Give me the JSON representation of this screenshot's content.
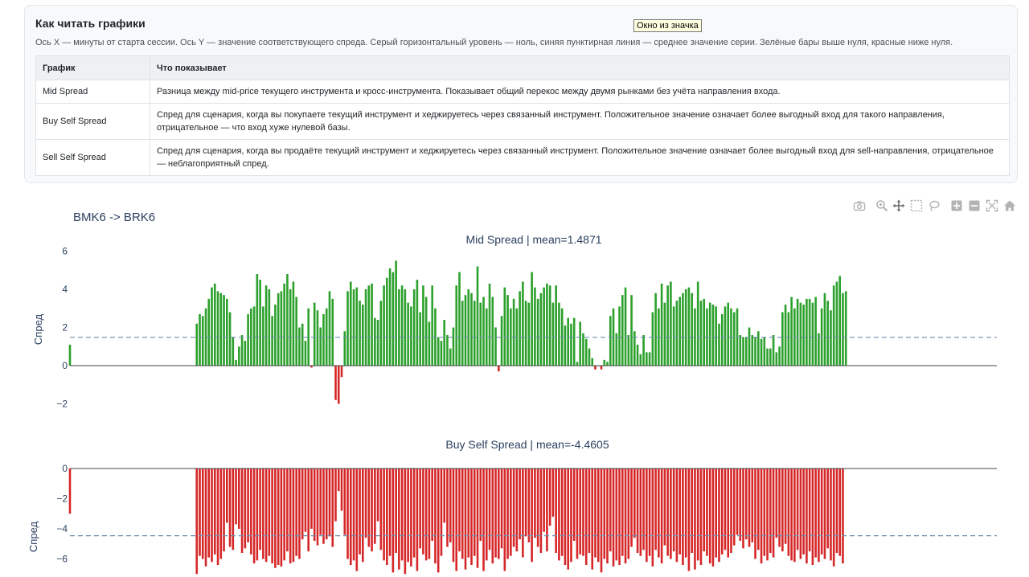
{
  "info": {
    "title": "Как читать графики",
    "description": "Ось X — минуты от старта сессии. Ось Y — значение соответствующего спреда. Серый горизонтальный уровень — ноль, синяя пунктирная линия — среднее значение серии. Зелёные бары выше нуля, красные ниже нуля.",
    "table": {
      "headers": [
        "График",
        "Что показывает"
      ],
      "rows": [
        {
          "name": "Mid Spread",
          "text": "Разница между mid-price текущего инструмента и кросс-инструмента. Показывает общий перекос между двумя рынками без учёта направления входа."
        },
        {
          "name": "Buy Self Spread",
          "text": "Спред для сценария, когда вы покупаете текущий инструмент и хеджируетесь через связанный инструмент. Положительное значение означает более выгодный вход для такого направления, отрицательное — что вход хуже нулевой базы."
        },
        {
          "name": "Sell Self Spread",
          "text": "Спред для сценария, когда вы продаёте текущий инструмент и хеджируетесь через связанный инструмент. Положительное значение означает более выгодный вход для sell-направления, отрицательное — неблагоприятный спред."
        }
      ]
    }
  },
  "tooltip": "Окно из значка",
  "modebar": [
    "camera-icon",
    "zoom-icon",
    "pan-icon",
    "box-select-icon",
    "lasso-icon",
    "zoom-in-icon",
    "zoom-out-icon",
    "autoscale-icon",
    "reset-home-icon"
  ],
  "figure_title": "BMK6 -> BRK6",
  "chart_data": [
    {
      "type": "bar",
      "title": "Mid Spread | mean=1.4871",
      "ylabel": "Спред",
      "yticks": [
        -2,
        0,
        2,
        4,
        6
      ],
      "ylim": [
        -2.5,
        6.3
      ],
      "mean": 1.4871,
      "colors": {
        "positive": "#2ca02c",
        "negative": "#d62728",
        "mean_line": "#6f8fb0",
        "zero_line": "#444444"
      },
      "x": [
        0,
        42,
        43,
        44,
        45,
        46,
        47,
        48,
        49,
        50,
        51,
        52,
        53,
        54,
        55,
        56,
        57,
        58,
        59,
        60,
        61,
        62,
        63,
        64,
        65,
        66,
        67,
        68,
        69,
        70,
        71,
        72,
        73,
        74,
        75,
        76,
        77,
        78,
        79,
        80,
        81,
        82,
        83,
        84,
        85,
        86,
        87,
        88,
        89,
        90,
        91,
        92,
        93,
        94,
        95,
        96,
        97,
        98,
        99,
        100,
        101,
        102,
        103,
        104,
        105,
        106,
        107,
        108,
        109,
        110,
        111,
        112,
        113,
        114,
        115,
        116,
        117,
        118,
        119,
        120,
        121,
        122,
        123,
        124,
        125,
        126,
        127,
        128,
        129,
        130,
        131,
        132,
        133,
        134,
        135,
        136,
        137,
        138,
        139,
        140,
        141,
        142,
        143,
        144,
        145,
        146,
        147,
        148,
        149,
        150,
        151,
        152,
        153,
        154,
        155,
        156,
        157,
        158,
        159,
        160,
        161,
        162,
        163,
        164,
        165,
        166,
        167,
        168,
        169,
        170,
        171,
        172,
        173,
        174,
        175,
        176,
        177,
        178,
        179,
        180,
        181,
        182,
        183,
        184,
        185,
        186,
        187,
        188,
        189,
        190,
        191,
        192,
        193,
        194,
        195,
        196,
        197,
        198,
        199,
        200,
        201,
        202,
        203,
        204,
        205,
        206,
        207,
        208,
        209,
        210,
        211,
        212,
        213,
        214,
        215,
        216,
        217,
        218,
        219,
        220,
        221,
        222,
        223,
        224,
        225,
        226,
        227,
        228,
        229,
        230,
        231,
        232,
        233,
        234,
        235,
        236,
        237,
        238,
        239,
        240,
        241,
        242,
        243,
        244,
        245,
        246,
        247,
        248,
        249,
        250,
        251,
        252,
        253,
        254,
        255,
        256,
        257,
        258,
        259,
        260,
        261,
        262,
        263,
        264,
        265,
        266,
        267,
        268,
        269,
        270,
        271,
        272,
        273,
        274,
        275,
        276,
        277,
        278,
        279,
        280,
        281,
        282,
        283,
        284,
        285,
        286,
        287,
        288,
        289,
        290,
        291,
        292,
        293,
        294,
        295,
        296,
        297,
        298,
        299,
        300,
        301,
        302,
        303,
        304,
        305,
        306,
        307
      ],
      "values": [
        1.1,
        2.2,
        2.7,
        2.6,
        3.0,
        3.5,
        4.1,
        4.3,
        3.9,
        3.8,
        3.7,
        3.5,
        2.8,
        1.5,
        0.3,
        1.0,
        1.6,
        1.3,
        2.7,
        3.0,
        3.1,
        4.8,
        4.5,
        3.1,
        4.2,
        4.0,
        2.6,
        3.2,
        3.8,
        3.9,
        4.3,
        4.8,
        4.0,
        4.4,
        3.6,
        2.0,
        2.2,
        1.3,
        3.0,
        -0.1,
        3.3,
        2.9,
        2.0,
        2.7,
        3.0,
        3.9,
        3.5,
        -1.8,
        -2.0,
        -0.6,
        1.8,
        3.9,
        4.4,
        4.0,
        4.1,
        3.4,
        3.2,
        4.0,
        4.2,
        4.3,
        2.5,
        2.4,
        3.4,
        4.2,
        4.6,
        5.1,
        4.9,
        5.5,
        4.0,
        4.2,
        4.0,
        3.3,
        3.1,
        4.0,
        4.5,
        2.8,
        4.2,
        3.6,
        2.3,
        4.2,
        3.0,
        1.5,
        1.3,
        2.4,
        1.6,
        0.9,
        2.0,
        4.2,
        4.9,
        3.4,
        3.7,
        4.0,
        3.8,
        3.4,
        5.2,
        3.3,
        3.6,
        3.0,
        4.3,
        3.6,
        2.0,
        -0.3,
        2.6,
        4.1,
        3.7,
        3.0,
        3.5,
        3.0,
        3.9,
        4.4,
        3.4,
        3.3,
        4.9,
        4.1,
        3.5,
        3.8,
        4.1,
        4.3,
        4.2,
        3.3,
        4.2,
        3.3,
        3.0,
        2.1,
        2.5,
        2.2,
        2.5,
        0.2,
        2.3,
        1.7,
        1.4,
        0.9,
        0.4,
        -0.2,
        0.0,
        -0.2,
        0.3,
        0.2,
        2.6,
        3.0,
        1.7,
        3.1,
        3.7,
        4.1,
        1.6,
        3.7,
        1.8,
        1.1,
        0.6,
        1.6,
        0.7,
        0.7,
        2.8,
        3.8,
        3.0,
        4.3,
        3.3,
        4.2,
        4.4,
        3.1,
        3.4,
        3.6,
        3.8,
        4.0,
        4.1,
        3.8,
        3.0,
        4.4,
        3.4,
        3.5,
        3.0,
        3.3,
        3.2,
        3.1,
        2.2,
        2.7,
        3.1,
        3.3,
        3.0,
        2.8,
        3.0,
        1.6,
        1.5,
        1.5,
        2.0,
        1.6,
        1.5,
        1.8,
        1.4,
        1.5,
        0.9,
        0.9,
        1.6,
        0.7,
        1.0,
        2.8,
        3.2,
        2.8,
        3.6,
        3.0,
        3.5,
        3.3,
        3.2,
        3.5,
        3.5,
        3.3,
        3.6,
        1.7,
        3.0,
        3.8,
        3.4,
        2.9,
        4.2,
        4.4,
        4.7,
        3.8,
        3.9
      ]
    },
    {
      "type": "bar",
      "title": "Buy Self Spread | mean=-4.4605",
      "ylabel": "Спред",
      "yticks": [
        -6,
        -4,
        -2,
        0
      ],
      "ylim": [
        -7.0,
        0.4
      ],
      "mean": -4.4605,
      "colors": {
        "positive": "#2ca02c",
        "negative": "#d62728",
        "mean_line": "#6f8fb0",
        "zero_line": "#444444"
      },
      "x": [
        0,
        42,
        43,
        44,
        45,
        46,
        47,
        48,
        49,
        50,
        51,
        52,
        53,
        54,
        55,
        56,
        57,
        58,
        59,
        60,
        61,
        62,
        63,
        64,
        65,
        66,
        67,
        68,
        69,
        70,
        71,
        72,
        73,
        74,
        75,
        76,
        77,
        78,
        79,
        80,
        81,
        82,
        83,
        84,
        85,
        86,
        87,
        88,
        89,
        90,
        91,
        92,
        93,
        94,
        95,
        96,
        97,
        98,
        99,
        100,
        101,
        102,
        103,
        104,
        105,
        106,
        107,
        108,
        109,
        110,
        111,
        112,
        113,
        114,
        115,
        116,
        117,
        118,
        119,
        120,
        121,
        122,
        123,
        124,
        125,
        126,
        127,
        128,
        129,
        130,
        131,
        132,
        133,
        134,
        135,
        136,
        137,
        138,
        139,
        140,
        141,
        142,
        143,
        144,
        145,
        146,
        147,
        148,
        149,
        150,
        151,
        152,
        153,
        154,
        155,
        156,
        157,
        158,
        159,
        160,
        161,
        162,
        163,
        164,
        165,
        166,
        167,
        168,
        169,
        170,
        171,
        172,
        173,
        174,
        175,
        176,
        177,
        178,
        179,
        180,
        181,
        182,
        183,
        184,
        185,
        186,
        187,
        188,
        189,
        190,
        191,
        192,
        193,
        194,
        195,
        196,
        197,
        198,
        199,
        200,
        201,
        202,
        203,
        204,
        205,
        206,
        207,
        208,
        209,
        210,
        211,
        212,
        213,
        214,
        215,
        216,
        217,
        218,
        219,
        220,
        221,
        222,
        223,
        224,
        225,
        226,
        227,
        228,
        229,
        230,
        231,
        232,
        233,
        234,
        235,
        236,
        237,
        238,
        239,
        240,
        241,
        242,
        243,
        244,
        245,
        246,
        247,
        248,
        249,
        250,
        251,
        252,
        253,
        254,
        255,
        256,
        257,
        258,
        259,
        260,
        261,
        262,
        263,
        264,
        265,
        266,
        267,
        268,
        269,
        270,
        271,
        272,
        273,
        274,
        275,
        276,
        277,
        278,
        279,
        280,
        281,
        282,
        283,
        284,
        285,
        286,
        287,
        288,
        289,
        290,
        291,
        292,
        293,
        294,
        295,
        296,
        297,
        298,
        299,
        300,
        301,
        302,
        303,
        304,
        305,
        306,
        307
      ],
      "values": [
        -3.0,
        -7.0,
        -5.8,
        -6.0,
        -6.5,
        -5.9,
        -6.2,
        -5.7,
        -6.4,
        -6.0,
        -5.5,
        -3.6,
        -5.2,
        -5.4,
        -3.7,
        -4.0,
        -5.6,
        -5.3,
        -4.9,
        -5.7,
        -6.3,
        -6.1,
        -5.4,
        -6.0,
        -6.2,
        -5.8,
        -6.3,
        -6.6,
        -6.4,
        -6.5,
        -6.1,
        -5.5,
        -6.3,
        -6.2,
        -5.8,
        -6.0,
        -4.7,
        -4.2,
        -5.5,
        -4.0,
        -4.8,
        -5.1,
        -4.4,
        -5.0,
        -4.7,
        -4.5,
        -5.2,
        -3.5,
        -1.5,
        -2.8,
        -4.4,
        -6.0,
        -6.4,
        -6.1,
        -6.8,
        -5.7,
        -6.2,
        -4.6,
        -5.2,
        -5.5,
        -5.0,
        -3.5,
        -5.4,
        -6.1,
        -6.4,
        -5.8,
        -6.9,
        -5.6,
        -6.7,
        -6.1,
        -7.0,
        -6.2,
        -6.5,
        -5.9,
        -6.8,
        -5.3,
        -5.7,
        -6.1,
        -6.0,
        -4.8,
        -6.3,
        -6.9,
        -5.8,
        -3.6,
        -5.2,
        -4.9,
        -6.2,
        -6.8,
        -5.5,
        -6.0,
        -6.7,
        -5.9,
        -6.4,
        -5.8,
        -6.6,
        -4.8,
        -6.8,
        -6.1,
        -5.4,
        -6.3,
        -5.9,
        -6.0,
        -5.3,
        -6.8,
        -6.0,
        -5.8,
        -5.2,
        -5.5,
        -4.7,
        -5.9,
        -4.5,
        -4.9,
        -6.2,
        -4.6,
        -5.2,
        -5.6,
        -4.2,
        -5.5,
        -3.8,
        -3.2,
        -5.6,
        -6.1,
        -5.8,
        -6.4,
        -6.7,
        -6.2,
        -4.8,
        -6.0,
        -5.7,
        -5.8,
        -6.4,
        -5.6,
        -6.7,
        -5.9,
        -6.2,
        -6.9,
        -6.0,
        -6.3,
        -5.5,
        -6.5,
        -6.1,
        -6.4,
        -5.8,
        -6.3,
        -6.0,
        -5.2,
        -4.6,
        -5.6,
        -5.8,
        -5.4,
        -6.2,
        -5.8,
        -6.5,
        -5.4,
        -5.9,
        -6.3,
        -5.1,
        -5.8,
        -6.0,
        -5.5,
        -6.2,
        -5.7,
        -6.4,
        -5.9,
        -6.8,
        -5.6,
        -6.7,
        -6.1,
        -6.4,
        -5.5,
        -5.8,
        -6.3,
        -6.5,
        -5.9,
        -6.2,
        -5.7,
        -5.4,
        -5.9,
        -5.6,
        -5.1,
        -4.4,
        -4.8,
        -5.3,
        -4.7,
        -5.2,
        -4.9,
        -6.0,
        -5.4,
        -6.3,
        -5.8,
        -6.1,
        -5.6,
        -5.9,
        -4.6,
        -5.2,
        -5.5,
        -5.0,
        -5.8,
        -6.1,
        -6.2,
        -5.4,
        -6.0,
        -5.7,
        -6.3,
        -5.5,
        -6.4,
        -5.9,
        -6.2,
        -5.7,
        -6.0,
        -5.3,
        -6.1,
        -6.5,
        -5.6,
        -5.8,
        -6.3
      ]
    }
  ]
}
